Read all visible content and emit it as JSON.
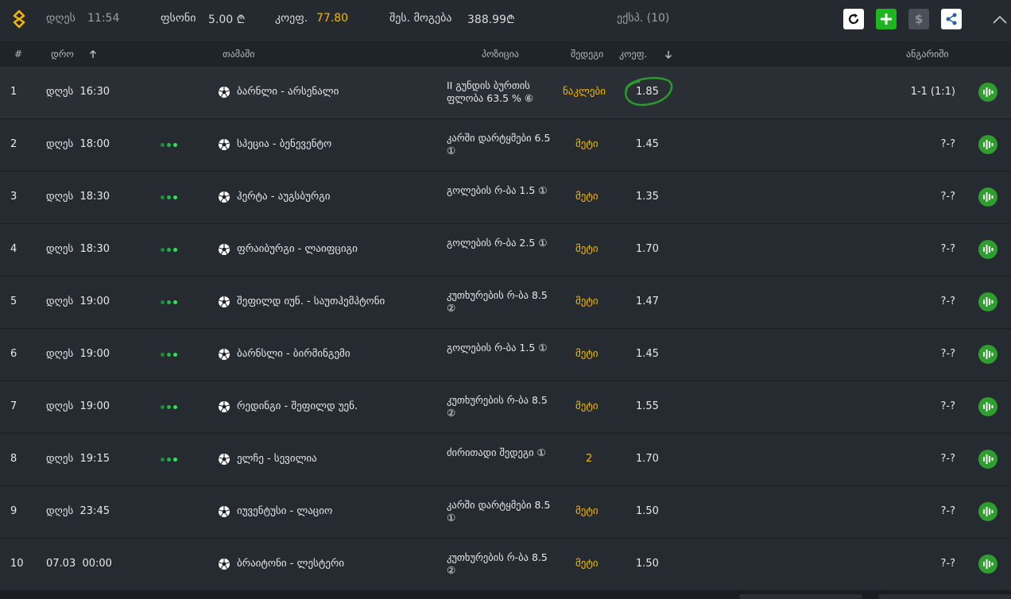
{
  "topbar": {
    "day": "დღეს",
    "time": "11:54",
    "stake_label": "ფსონი",
    "stake_value": "5.00 ₾",
    "odds_label": "კოეფ.",
    "odds_value": "77.80",
    "payout_label": "შეს. მოგება",
    "payout_value": "388.99₾",
    "express": "ექსპ. (10)",
    "icons": [
      "refresh-icon",
      "plus-icon",
      "dollar-icon",
      "share-icon",
      "chevron-up-icon"
    ],
    "colors": {
      "accent": "#f5b800",
      "green": "#1fb51f"
    }
  },
  "columns": {
    "num": "#",
    "time": "დრო",
    "game": "თამაში",
    "position": "პოზიცია",
    "outcome": "შედეგი",
    "odds": "კოეფ.",
    "settlement": "ანგარიში"
  },
  "rows": [
    {
      "num": "1",
      "date": "დღეს",
      "time": "16:30",
      "live": false,
      "game": "ბარნლი - არსენალი",
      "position": "II გუნდის ბურთის ფლობა 63.5 % ⑥",
      "outcome": "ნაკლები",
      "odds": "1.85",
      "score": "1-1 (1:1)"
    },
    {
      "num": "2",
      "date": "დღეს",
      "time": "18:00",
      "live": true,
      "game": "სპეცია - ბენევენტო",
      "position": "კარში დარტყმები 6.5 ①",
      "outcome": "მეტი",
      "odds": "1.45",
      "score": "?-?"
    },
    {
      "num": "3",
      "date": "დღეს",
      "time": "18:30",
      "live": true,
      "game": "ჰერტა - აუგსბურგი",
      "position": "გოლების რ-ბა 1.5 ①",
      "outcome": "მეტი",
      "odds": "1.35",
      "score": "?-?"
    },
    {
      "num": "4",
      "date": "დღეს",
      "time": "18:30",
      "live": true,
      "game": "ფრაიბურგი - ლაიფციგი",
      "position": "გოლების რ-ბა 2.5 ①",
      "outcome": "მეტი",
      "odds": "1.70",
      "score": "?-?"
    },
    {
      "num": "5",
      "date": "დღეს",
      "time": "19:00",
      "live": true,
      "game": "შეფილდ იუნ. - საუთჰემპტონი",
      "position": "კუთხურების რ-ბა 8.5 ②",
      "outcome": "მეტი",
      "odds": "1.47",
      "score": "?-?"
    },
    {
      "num": "6",
      "date": "დღეს",
      "time": "19:00",
      "live": true,
      "game": "ბარნსლი - ბირმინგემი",
      "position": "გოლების რ-ბა 1.5 ①",
      "outcome": "მეტი",
      "odds": "1.45",
      "score": "?-?"
    },
    {
      "num": "7",
      "date": "დღეს",
      "time": "19:00",
      "live": true,
      "game": "რედინგი - შეფილდ უენ.",
      "position": "კუთხურების რ-ბა 8.5 ②",
      "outcome": "მეტი",
      "odds": "1.55",
      "score": "?-?"
    },
    {
      "num": "8",
      "date": "დღეს",
      "time": "19:15",
      "live": true,
      "game": "ელჩე - სევილია",
      "position": "ძირითადი შედეგი ①",
      "outcome": "2",
      "odds": "1.70",
      "score": "?-?"
    },
    {
      "num": "9",
      "date": "დღეს",
      "time": "23:45",
      "live": false,
      "game": "იუვენტუსი - ლაციო",
      "position": "კარში დარტყმები 8.5 ①",
      "outcome": "მეტი",
      "odds": "1.50",
      "score": "?-?"
    },
    {
      "num": "10",
      "date": "07.03",
      "time": "00:00",
      "live": false,
      "game": "ბრაიტონი - ლესტერი",
      "position": "კუთხურების რ-ბა 8.5 ②",
      "outcome": "მეტი",
      "odds": "1.50",
      "score": "?-?"
    }
  ]
}
